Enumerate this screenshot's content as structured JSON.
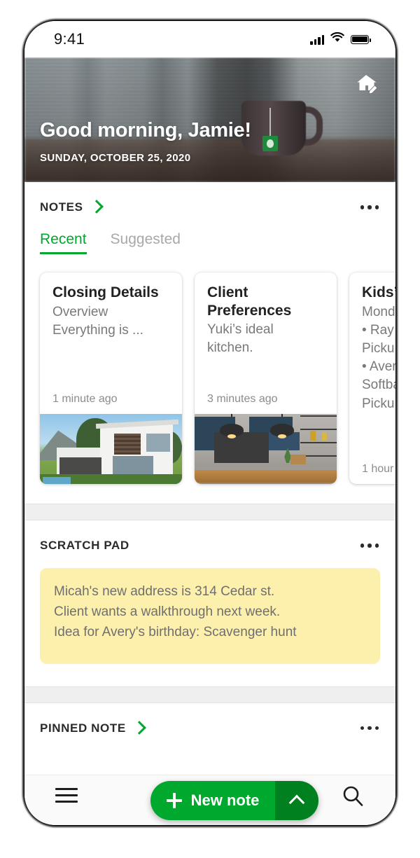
{
  "status_bar": {
    "time": "9:41",
    "signal_icon": "signal-bars-icon",
    "wifi_icon": "wifi-icon",
    "battery_icon": "battery-full-icon"
  },
  "hero": {
    "greeting": "Good morning, Jamie!",
    "date": "SUNDAY, OCTOBER 25, 2020",
    "action_icon": "home-edit-icon"
  },
  "notes_section": {
    "title": "NOTES",
    "chevron_icon": "chevron-right-icon",
    "overflow_icon": "kebab-menu-icon",
    "tabs": [
      {
        "label": "Recent",
        "active": true
      },
      {
        "label": "Suggested",
        "active": false
      }
    ],
    "cards": [
      {
        "title": "Closing Details",
        "line1": "Overview",
        "line2": "Everything is ...",
        "line3": "",
        "time": "1 minute ago",
        "thumb": "modern-house-photo"
      },
      {
        "title": "Client Preferences",
        "line1": "Yuki’s ideal",
        "line2": "kitchen.",
        "line3": "",
        "time": "3 minutes ago",
        "thumb": "kitchen-interior-photo"
      },
      {
        "title": "Kids’",
        "line1": "Mond",
        "line2": "• Ray –",
        "line3": "Picku",
        "line4": "• Aver",
        "line5": "Softba",
        "line6": "Picku",
        "time": "1 hour",
        "thumb": "none"
      }
    ]
  },
  "scratch_pad": {
    "title": "SCRATCH PAD",
    "overflow_icon": "kebab-menu-icon",
    "lines": [
      "Micah's new address is 314 Cedar st.",
      "Client wants a walkthrough next week.",
      "Idea for Avery's birthday: Scavenger hunt"
    ]
  },
  "pinned_note": {
    "title": "PINNED NOTE",
    "chevron_icon": "chevron-right-icon",
    "overflow_icon": "kebab-menu-icon"
  },
  "fab": {
    "label": "New note",
    "plus_icon": "plus-icon",
    "caret_icon": "chevron-up-icon"
  },
  "bottom_nav": {
    "menu_icon": "hamburger-menu-icon",
    "search_icon": "search-icon"
  },
  "colors": {
    "accent_green": "#00a82d",
    "accent_green_dark": "#00801f",
    "scratch_yellow": "#fdf0ad",
    "band_gray": "#efefef"
  }
}
